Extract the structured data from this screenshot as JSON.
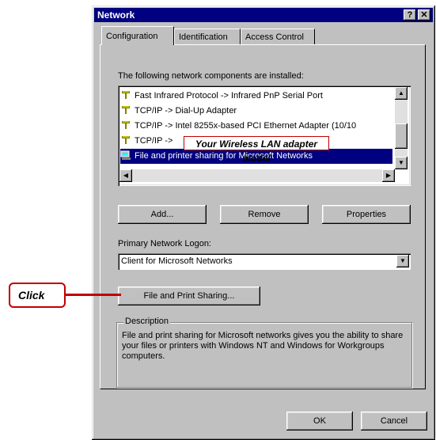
{
  "window": {
    "title": "Network",
    "help_btn": "?",
    "close_btn": "✕"
  },
  "tabs": [
    {
      "label": "Configuration"
    },
    {
      "label": "Identification"
    },
    {
      "label": "Access Control"
    }
  ],
  "components": {
    "label": "The following network components are installed:",
    "items": [
      {
        "label": "Fast Infrared Protocol -> Infrared PnP Serial Port",
        "icon": "protocol-icon"
      },
      {
        "label": "TCP/IP -> Dial-Up Adapter",
        "icon": "protocol-icon"
      },
      {
        "label": "TCP/IP -> Intel 8255x-based PCI Ethernet Adapter (10/10",
        "icon": "protocol-icon"
      },
      {
        "label": "TCP/IP ->",
        "icon": "protocol-icon"
      },
      {
        "label": "File and printer sharing for Microsoft Networks",
        "icon": "sharing-service-icon"
      }
    ],
    "annotation": "Your Wireless LAN adapter model"
  },
  "buttons": {
    "add": "Add...",
    "remove": "Remove",
    "properties": "Properties",
    "file_print_sharing": "File and Print Sharing...",
    "ok": "OK",
    "cancel": "Cancel"
  },
  "logon": {
    "label": "Primary Network Logon:",
    "value": "Client for Microsoft Networks"
  },
  "description": {
    "label": "Description",
    "text": "File and print sharing for Microsoft networks gives you the ability to share your files or printers with Windows NT and Windows for Workgroups computers."
  },
  "callout": {
    "text": "Click"
  },
  "colors": {
    "titlebar": "#000080",
    "selection": "#000080",
    "callout_red": "#c00000",
    "face": "#c0c0c0"
  }
}
